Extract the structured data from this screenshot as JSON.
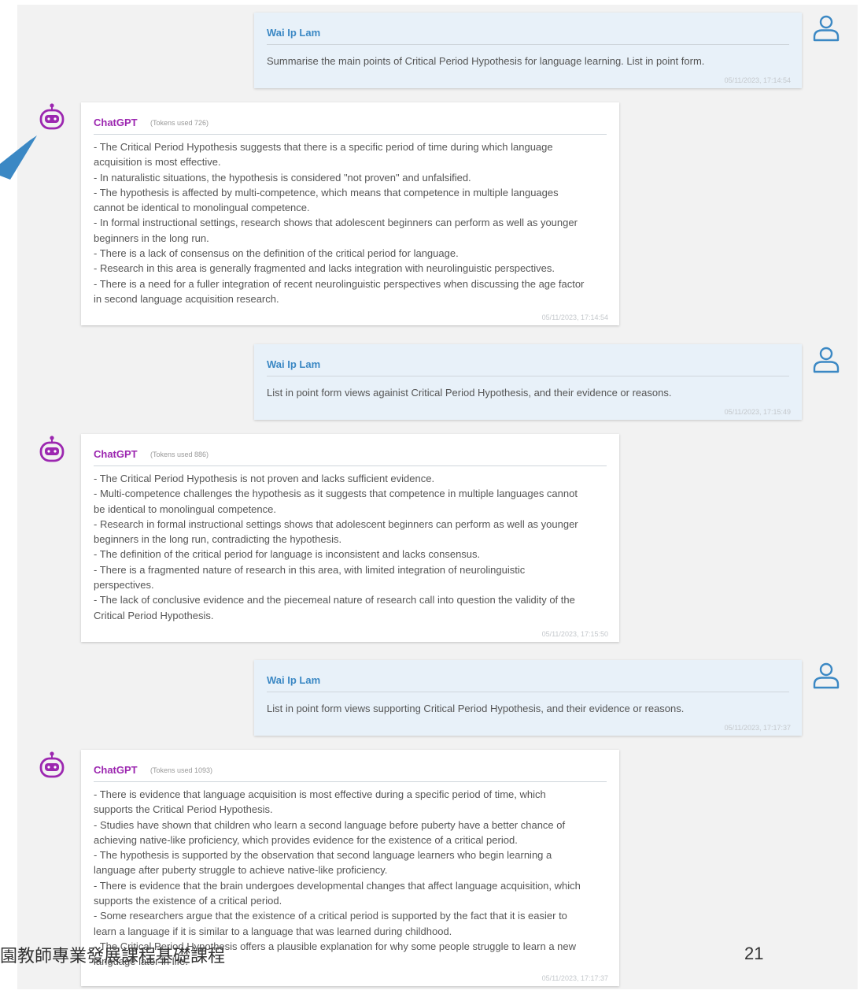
{
  "conversation": {
    "user_name": "Wai Ip Lam",
    "bot_name": "ChatGPT",
    "messages": [
      {
        "role": "user",
        "text": "Summarise the main points of Critical Period Hypothesis for language learning. List in point form.",
        "time": "05/11/2023, 17:14:54"
      },
      {
        "role": "bot",
        "tokens": "(Tokens used 726)",
        "text": "- The Critical Period Hypothesis suggests that there is a specific period of time during which language\nacquisition is most effective.\n- In naturalistic situations, the hypothesis is considered \"not proven\" and unfalsified.\n- The hypothesis is affected by multi-competence, which means that competence in multiple languages\ncannot be identical to monolingual competence.\n- In formal instructional settings, research shows that adolescent beginners can perform as well as younger\nbeginners in the long run.\n- There is a lack of consensus on the definition of the critical period for language.\n- Research in this area is generally fragmented and lacks integration with neurolinguistic perspectives.\n- There is a need for a fuller integration of recent neurolinguistic perspectives when discussing the age factor\nin second language acquisition research.",
        "time": "05/11/2023, 17:14:54"
      },
      {
        "role": "user",
        "text": "List in point form views againist Critical Period Hypothesis, and their evidence or reasons.",
        "time": "05/11/2023, 17:15:49"
      },
      {
        "role": "bot",
        "tokens": "(Tokens used 886)",
        "text": "- The Critical Period Hypothesis is not proven and lacks sufficient evidence.\n- Multi-competence challenges the hypothesis as it suggests that competence in multiple languages cannot\nbe identical to monolingual competence.\n- Research in formal instructional settings shows that adolescent beginners can perform as well as younger\nbeginners in the long run, contradicting the hypothesis.\n- The definition of the critical period for language is inconsistent and lacks consensus.\n- There is a fragmented nature of research in this area, with limited integration of neurolinguistic\nperspectives.\n- The lack of conclusive evidence and the piecemeal nature of research call into question the validity of the\nCritical Period Hypothesis.",
        "time": "05/11/2023, 17:15:50"
      },
      {
        "role": "user",
        "text": "List in point form views supporting Critical Period Hypothesis, and their evidence or reasons.",
        "time": "05/11/2023, 17:17:37"
      },
      {
        "role": "bot",
        "tokens": "(Tokens used 1093)",
        "text": "- There is evidence that language acquisition is most effective during a specific period of time, which\nsupports the Critical Period Hypothesis.\n- Studies have shown that children who learn a second language before puberty have a better chance of\nachieving native-like proficiency, which provides evidence for the existence of a critical period.\n- The hypothesis is supported by the observation that second language learners who begin learning a\nlanguage after puberty struggle to achieve native-like proficiency.\n- There is evidence that the brain undergoes developmental changes that affect language acquisition, which\nsupports the existence of a critical period.\n- Some researchers argue that the existence of a critical period is supported by the fact that it is easier to\nlearn a language if it is similar to a language that was learned during childhood.\n- The Critical Period Hypothesis offers a plausible explanation for why some people struggle to learn a new\nlanguage later in life.",
        "time": "05/11/2023, 17:17:37"
      }
    ]
  },
  "footer": {
    "course_text": "園教師專業發展課程基礎課程",
    "page_number": "21"
  },
  "colors": {
    "user_name": "#3b88c4",
    "bot_name": "#9c27b0",
    "user_bubble": "#e8f1f9",
    "arrow": "#3b88c4"
  },
  "icons": {
    "user_avatar": "person-outline-icon",
    "bot_avatar": "robot-icon",
    "pointer": "callout-arrow"
  }
}
